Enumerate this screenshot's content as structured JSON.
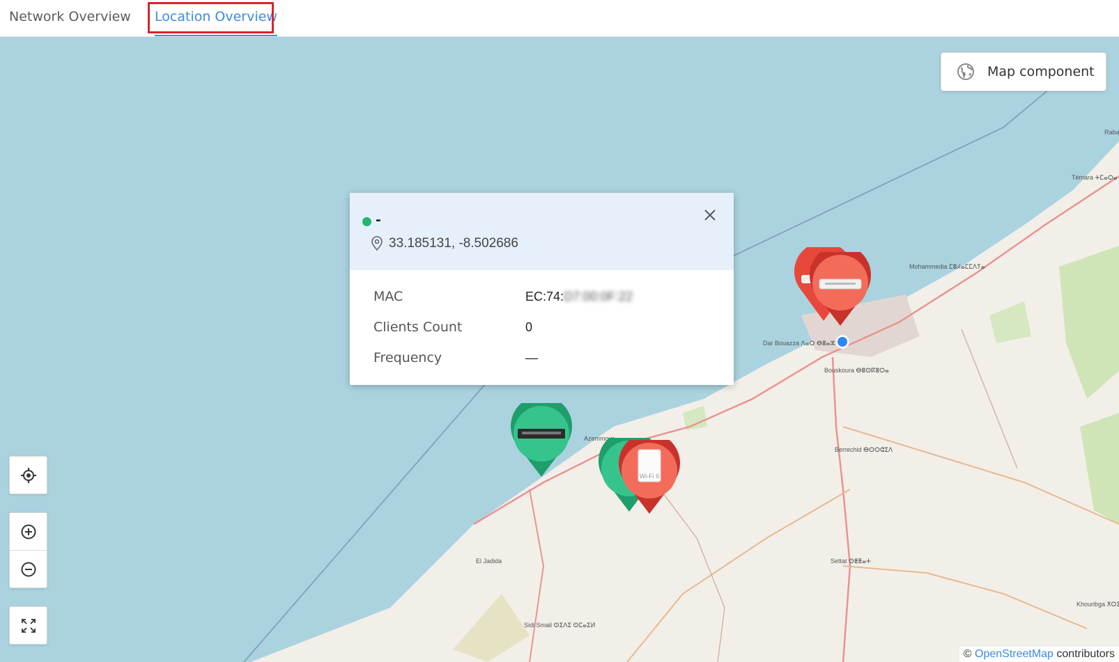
{
  "tabs": [
    {
      "label": "Network Overview"
    },
    {
      "label": "Location Overview"
    }
  ],
  "map_component": {
    "label": "Map component",
    "icon": "globe-icon"
  },
  "popup": {
    "name": "-",
    "status_color": "#22b573",
    "coordinates": "33.185131, -8.502686",
    "rows": [
      {
        "key": "MAC",
        "value": "EC:74:",
        "value_obscured": "D7:00:0F:22"
      },
      {
        "key": "Clients Count",
        "value": "0"
      },
      {
        "key": "Frequency",
        "value": "—"
      }
    ]
  },
  "controls": {
    "locate": "crosshair-icon",
    "zoom_in": "zoom-in-icon",
    "zoom_out": "zoom-out-icon",
    "fullscreen": "fullscreen-icon"
  },
  "map_labels": [
    "Rabat",
    "Témara ⵜⵎⴰⵔⴰ",
    "Mohammedia ⵎⵓⵃⴰⵎⵎⴷⵢⴰ",
    "Dar Bouazza ⴷⴰⵔ ⴱⵓⴰⵣⵣⴰ",
    "Bouskoura ⴱⵓⵙⴽⵓⵔⴰ",
    "Berrechid ⴱⵔⵔⵛⵉⴷ",
    "Settat ⵙⵟⵟⴰⵜ",
    "Khouribga ⵅⵔⵉⴱⴳⴰ",
    "Azemmour",
    "Sidi Smail ⵙⵉⴷⵉ ⵙⵎⴰⵉⵍ",
    "El Jadida"
  ],
  "pin_labels": {
    "wifi": "Wi-Fi 6"
  },
  "attribution": {
    "prefix": "©",
    "link": "OpenStreetMap",
    "suffix": "contributors"
  },
  "colors": {
    "accent": "#3f8ae0",
    "online": "#22b573",
    "offline": "#e8473b",
    "highlight": "#d8242a"
  }
}
